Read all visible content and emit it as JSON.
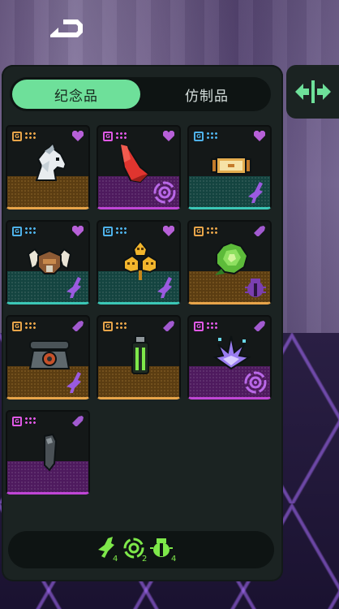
{
  "tabs": [
    {
      "label": "纪念品",
      "active": true
    },
    {
      "label": "仿制品",
      "active": false
    }
  ],
  "colors": {
    "accent_green": "#6ee09a",
    "rarity_orange": "#e8a54a",
    "rarity_purple": "#c046d6",
    "rarity_teal": "#3bc7b6",
    "heart": "#b760d8"
  },
  "cards": [
    {
      "item": "horse-head-icon",
      "rarity": "orange",
      "badge": "G",
      "fav": "heart-icon",
      "set": null
    },
    {
      "item": "red-shard-icon",
      "rarity": "purple",
      "badge": "G",
      "fav": "heart-icon",
      "set": "spiral-set-icon"
    },
    {
      "item": "scroll-bar-icon",
      "rarity": "teal",
      "badge": "G",
      "fav": "heart-icon",
      "set": "feather-set-icon"
    },
    {
      "item": "horned-helmet-icon",
      "rarity": "teal",
      "badge": "G",
      "fav": "heart-icon",
      "set": "feather-set-icon"
    },
    {
      "item": "golden-skull-icon",
      "rarity": "teal",
      "badge": "G",
      "fav": "heart-icon",
      "set": "feather-set-icon"
    },
    {
      "item": "green-rose-icon",
      "rarity": "orange",
      "badge": "G",
      "fav": "tag-icon",
      "set": "beetle-set-icon"
    },
    {
      "item": "rotary-phone-icon",
      "rarity": "orange",
      "badge": "G",
      "fav": "tag-icon",
      "set": "feather-set-icon"
    },
    {
      "item": "glow-vial-icon",
      "rarity": "orange",
      "badge": "G",
      "fav": "tag-icon",
      "set": null
    },
    {
      "item": "crystal-burst-icon",
      "rarity": "purple",
      "badge": "G",
      "fav": "tag-icon",
      "set": "spiral-set-icon"
    },
    {
      "item": "dark-stone-icon",
      "rarity": "purple",
      "badge": "G",
      "fav": "tag-icon",
      "set": null
    }
  ],
  "footer": {
    "counts": [
      {
        "icon": "feather-set-icon",
        "count": "4"
      },
      {
        "icon": "spiral-set-icon",
        "count": "2"
      },
      {
        "icon": "beetle-set-icon",
        "count": "4"
      }
    ]
  }
}
